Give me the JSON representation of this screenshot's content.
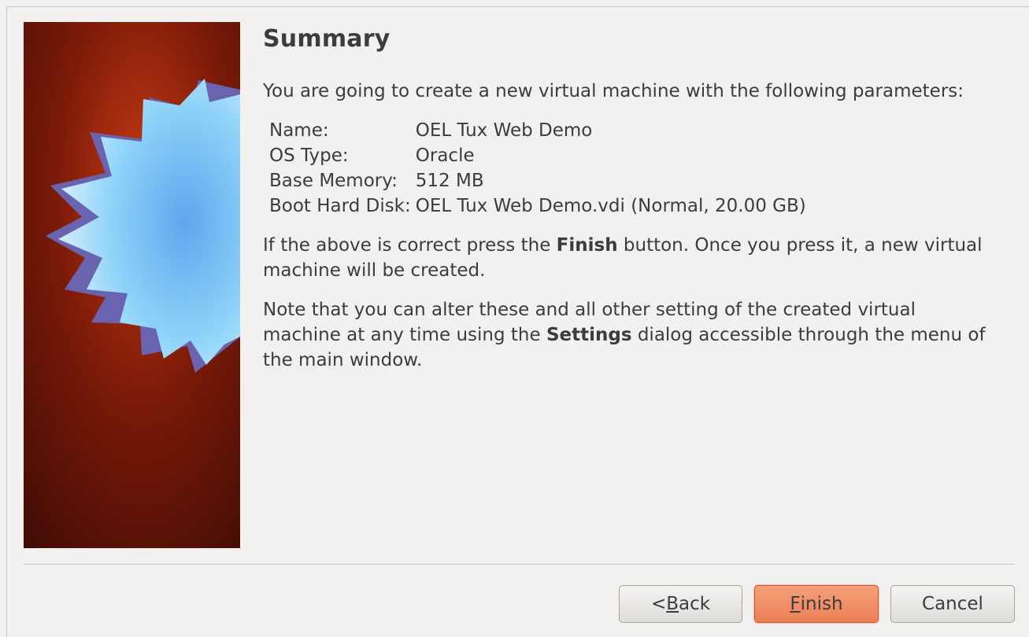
{
  "dialog": {
    "title": "Summary",
    "intro": "You are going to create a new virtual machine with the following parameters:",
    "parameters": [
      {
        "label": "Name:",
        "value": "OEL Tux Web Demo"
      },
      {
        "label": "OS Type:",
        "value": "Oracle"
      },
      {
        "label": "Base Memory:",
        "value": "512 MB"
      },
      {
        "label": "Boot Hard Disk:",
        "value": "OEL Tux Web Demo.vdi (Normal, 20.00 GB)"
      }
    ],
    "finish_note": {
      "before": "If the above is correct press the ",
      "bold": "Finish",
      "after": " button. Once you press it, a new virtual machine will be created."
    },
    "settings_note": {
      "before": "Note that you can alter these and all other setting of the created virtual machine at any time using the ",
      "bold": "Settings",
      "after": " dialog accessible through the menu of the main window."
    }
  },
  "buttons": {
    "back_prefix": "< ",
    "back_mnemonic": "B",
    "back_rest": "ack",
    "finish_mnemonic": "F",
    "finish_rest": "inish",
    "cancel": "Cancel"
  },
  "banner": {
    "icon": "starburst-icon",
    "colors": {
      "background": "#5c1005",
      "accent": "#e07a55",
      "star": "#8ad0f8"
    }
  }
}
